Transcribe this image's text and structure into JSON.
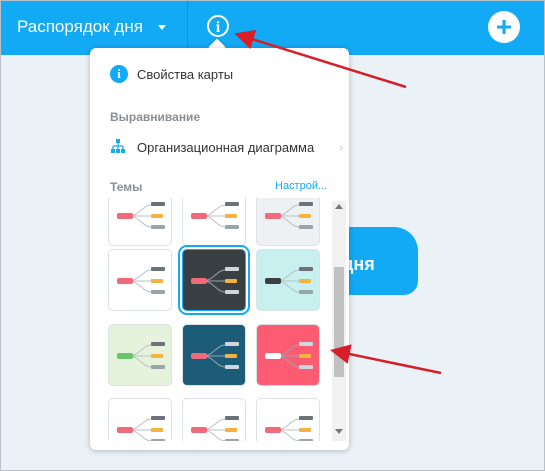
{
  "topbar": {
    "title": "Распорядок дня",
    "add_icon": "plus-icon",
    "info_icon": "info-icon"
  },
  "canvas": {
    "node_text": "дня"
  },
  "popup": {
    "map_properties": "Свойства карты",
    "alignment_section": "Выравнивание",
    "layout_option": "Организационная диаграмма",
    "themes_section": "Темы",
    "customize_link": "Настрой...",
    "themes": [
      {
        "bg": "#ffffff",
        "selected": false
      },
      {
        "bg": "#ffffff",
        "selected": false
      },
      {
        "bg": "#eef1f3",
        "selected": false
      },
      {
        "bg": "#ffffff",
        "selected": false
      },
      {
        "bg": "#3a3f44",
        "selected": true
      },
      {
        "bg": "#c8f0ef",
        "selected": false
      },
      {
        "bg": "#e6f3dc",
        "selected": false
      },
      {
        "bg": "#1d5c78",
        "selected": false
      },
      {
        "bg": "#fb5c72",
        "selected": false
      },
      {
        "bg": "#ffffff",
        "selected": false
      },
      {
        "bg": "#ffffff",
        "selected": false
      },
      {
        "bg": "#ffffff",
        "selected": false
      }
    ]
  },
  "colors": {
    "accent": "#12a9f5",
    "annotation_arrow": "#d81e28"
  }
}
